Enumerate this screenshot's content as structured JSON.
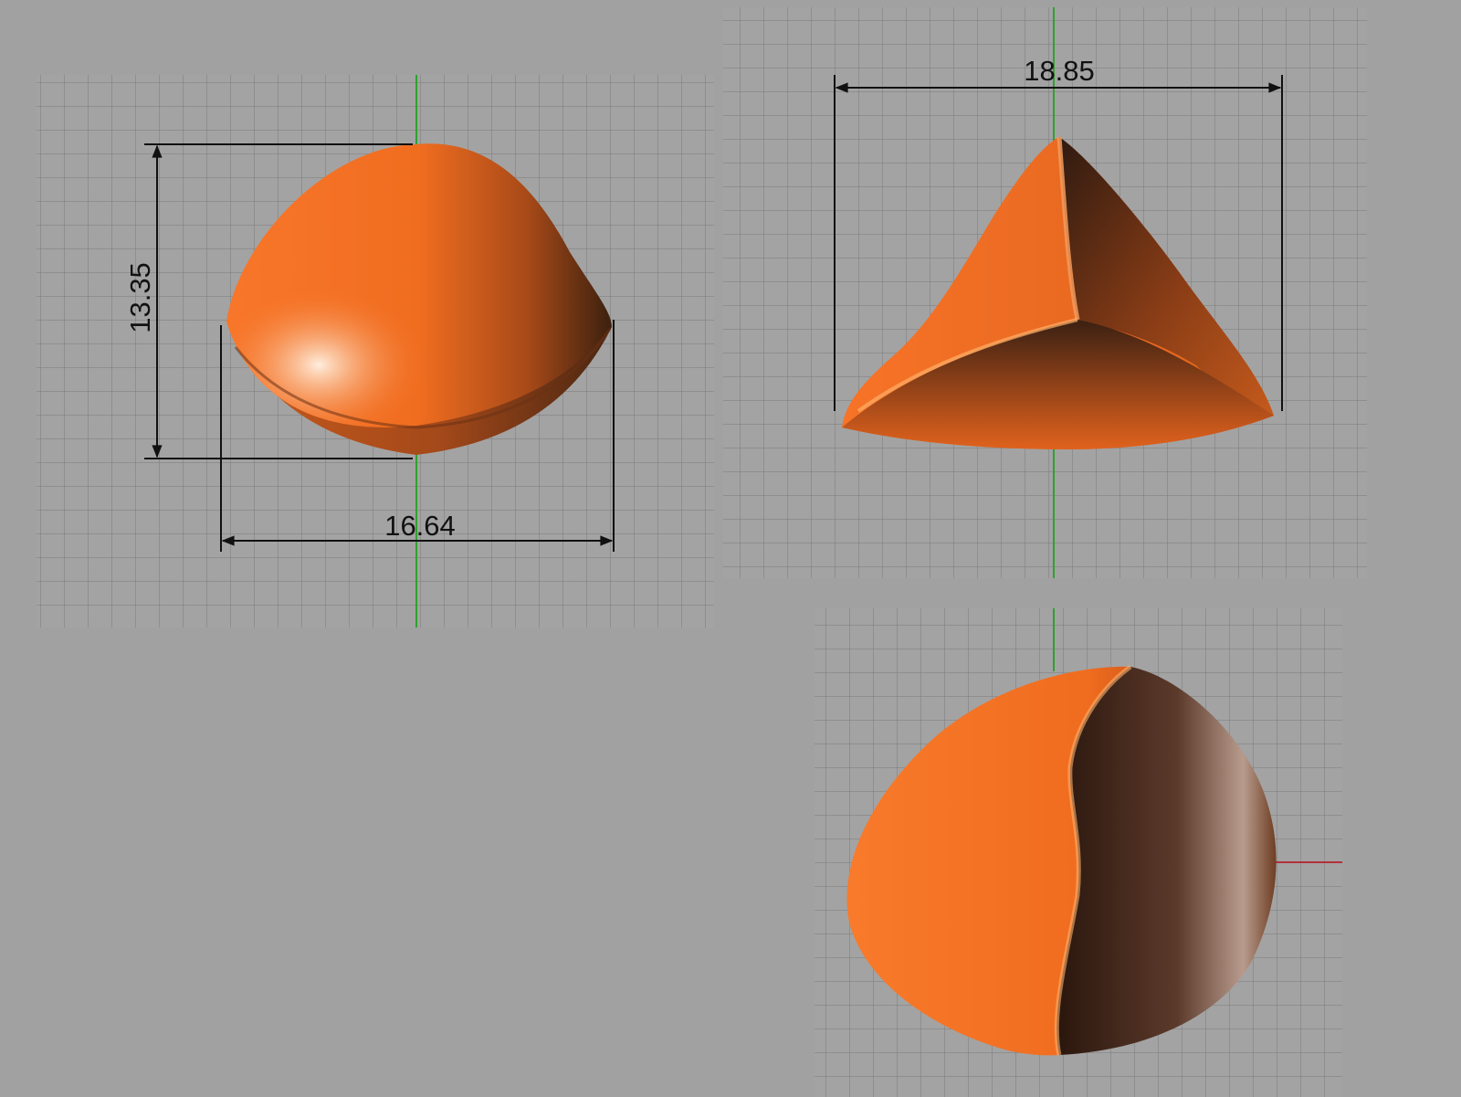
{
  "viewports": [
    {
      "name": "top",
      "dimensions": {
        "width": "16.64",
        "height": "13.35"
      }
    },
    {
      "name": "front",
      "dimensions": {
        "width": "18.85"
      }
    },
    {
      "name": "right",
      "dimensions": {}
    }
  ],
  "colors": {
    "background": "#a1a1a1",
    "grid": "#7d7d7d",
    "y_axis": "#2fa12f",
    "x_axis": "#b3303a",
    "model_orange": "#f26f1f",
    "model_shadow": "#3a1f12",
    "dimension_line": "#111111"
  }
}
